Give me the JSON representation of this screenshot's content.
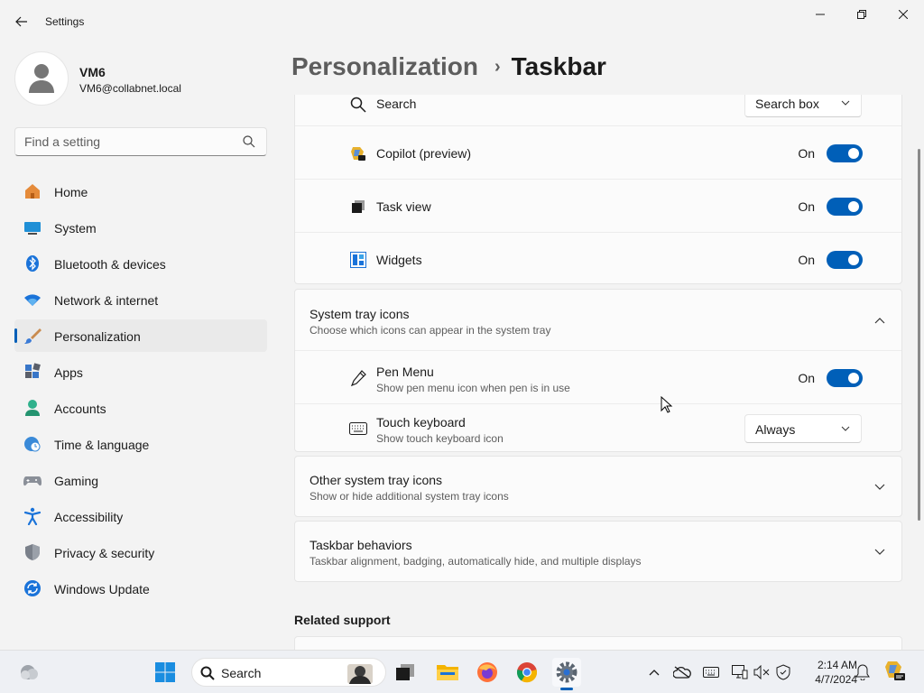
{
  "window": {
    "title": "Settings"
  },
  "profile": {
    "name": "VM6",
    "email": "VM6@collabnet.local"
  },
  "search": {
    "placeholder": "Find a setting"
  },
  "nav": {
    "items": [
      {
        "label": "Home",
        "icon": "home-icon"
      },
      {
        "label": "System",
        "icon": "system-icon"
      },
      {
        "label": "Bluetooth & devices",
        "icon": "bluetooth-icon"
      },
      {
        "label": "Network & internet",
        "icon": "wifi-icon"
      },
      {
        "label": "Personalization",
        "icon": "brush-icon",
        "active": true
      },
      {
        "label": "Apps",
        "icon": "apps-icon"
      },
      {
        "label": "Accounts",
        "icon": "accounts-icon"
      },
      {
        "label": "Time & language",
        "icon": "clock-globe-icon"
      },
      {
        "label": "Gaming",
        "icon": "gamepad-icon"
      },
      {
        "label": "Accessibility",
        "icon": "accessibility-icon"
      },
      {
        "label": "Privacy & security",
        "icon": "shield-icon"
      },
      {
        "label": "Windows Update",
        "icon": "update-icon"
      }
    ]
  },
  "header": {
    "parent": "Personalization",
    "separator": "›",
    "current": "Taskbar"
  },
  "taskbar_items": {
    "search": {
      "label": "Search",
      "value": "Search box"
    },
    "copilot": {
      "label": "Copilot (preview)",
      "state": "On"
    },
    "task_view": {
      "label": "Task view",
      "state": "On"
    },
    "widgets": {
      "label": "Widgets",
      "state": "On"
    }
  },
  "system_tray": {
    "title": "System tray icons",
    "description": "Choose which icons can appear in the system tray",
    "pen_menu": {
      "label": "Pen Menu",
      "description": "Show pen menu icon when pen is in use",
      "state": "On"
    },
    "touch_keyboard": {
      "label": "Touch keyboard",
      "description": "Show touch keyboard icon",
      "value": "Always"
    }
  },
  "other_tray": {
    "title": "Other system tray icons",
    "description": "Show or hide additional system tray icons"
  },
  "behaviors": {
    "title": "Taskbar behaviors",
    "description": "Taskbar alignment, badging, automatically hide, and multiple displays"
  },
  "related": {
    "title": "Related support"
  },
  "os_taskbar": {
    "search_label": "Search",
    "time": "2:14 AM",
    "date": "4/7/2024"
  },
  "colors": {
    "accent": "#005fb8",
    "background": "#f3f3f3",
    "card": "#fbfbfb"
  }
}
